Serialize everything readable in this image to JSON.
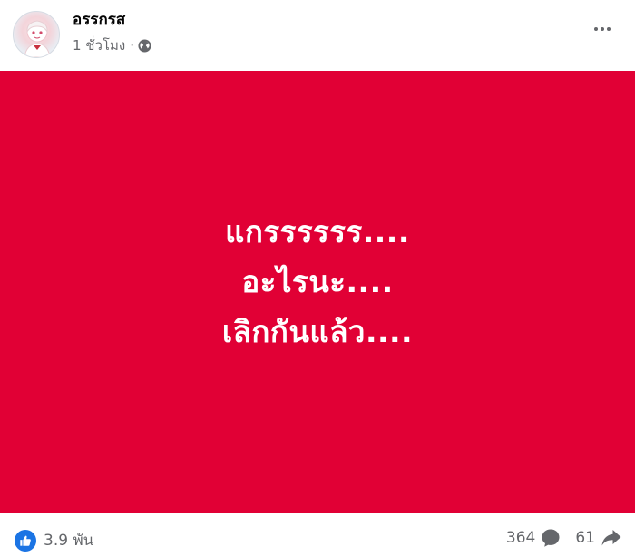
{
  "post": {
    "author": "อรรกรส",
    "time": "1 ชั่วโมง",
    "separator": "·",
    "privacy_icon": "globe-icon",
    "more_icon": "more-horizontal-icon"
  },
  "content": {
    "background": "#e10035",
    "lines": [
      "แกรรรรรร....",
      "อะไรนะ....",
      "เลิกกันแล้ว...."
    ]
  },
  "footer": {
    "reaction_icon": "like-icon",
    "reactions": "3.9 พัน",
    "comments": "364",
    "comment_icon": "comment-icon",
    "shares": "61",
    "share_icon": "share-arrow-icon",
    "accent": "#1b74e4"
  }
}
